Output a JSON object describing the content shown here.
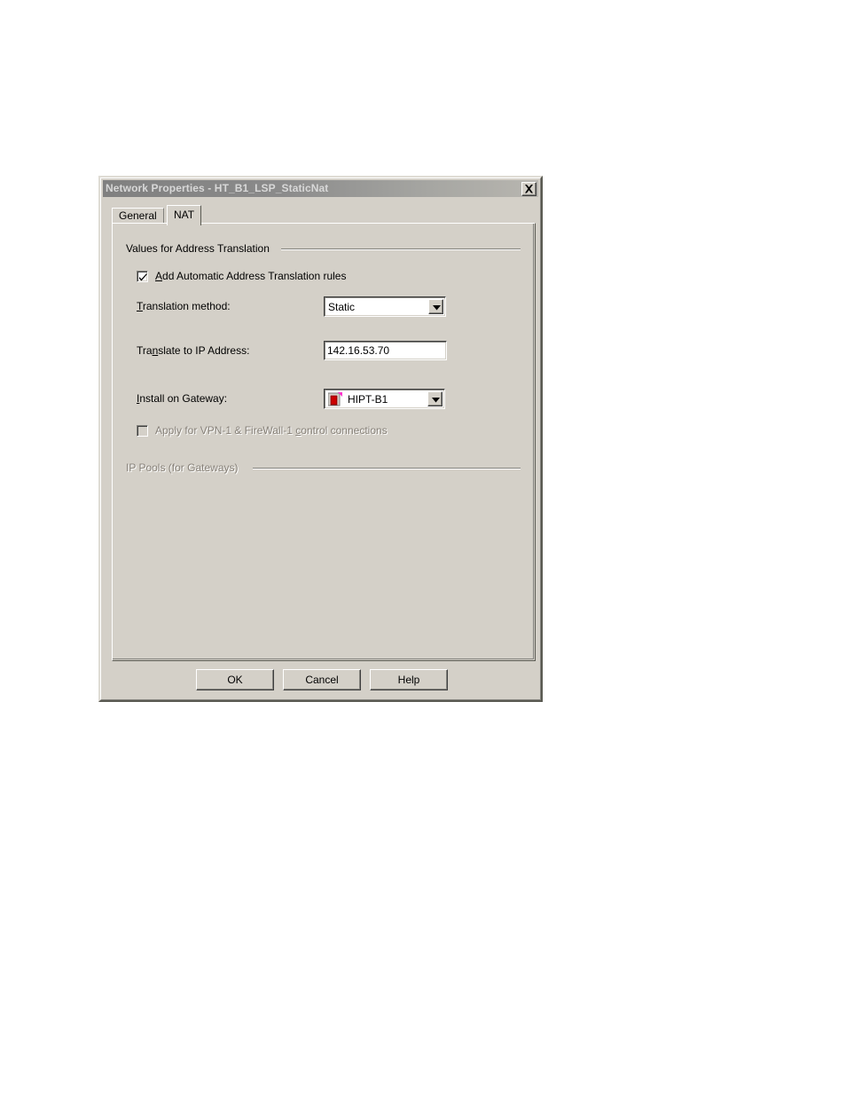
{
  "window": {
    "title": "Network Properties - HT_B1_LSP_StaticNat",
    "close_icon": "close-icon"
  },
  "tabs": [
    {
      "label": "General",
      "active": false
    },
    {
      "label": "NAT",
      "active": true
    }
  ],
  "groups": {
    "values_for_address_translation": "Values for Address Translation",
    "ip_pools": "IP Pools (for Gateways)"
  },
  "fields": {
    "add_auto_nat": {
      "label_accel": "A",
      "label_rest": "dd Automatic Address Translation rules",
      "checked": true,
      "enabled": true
    },
    "translation_method": {
      "label_accel": "T",
      "label_rest": "ranslation method:",
      "value": "Static",
      "options": [
        "Static"
      ]
    },
    "translate_to_ip": {
      "label_pre": "Tra",
      "label_accel": "n",
      "label_rest": "slate to IP Address:",
      "value": "142.16.53.70"
    },
    "install_on_gateway": {
      "label_accel": "I",
      "label_rest": "nstall on Gateway:",
      "value": "HIPT-B1",
      "icon": "gateway-icon",
      "options": [
        "HIPT-B1"
      ]
    },
    "apply_vpn_fw": {
      "label_pre": "Apply for VPN-1 & FireWall-1 ",
      "label_accel": "c",
      "label_rest": "ontrol connections",
      "checked": false,
      "enabled": false
    }
  },
  "buttons": {
    "ok": "OK",
    "cancel": "Cancel",
    "help": "Help"
  },
  "colors": {
    "face": "#d4d0c8",
    "titlebar_start": "#808080",
    "titlebar_end": "#b8b6b0",
    "title_text": "#d8d8d8",
    "disabled_text": "#868078",
    "gateway_icon_body": "#cc0000",
    "gateway_icon_flag": "#ff33cc"
  }
}
